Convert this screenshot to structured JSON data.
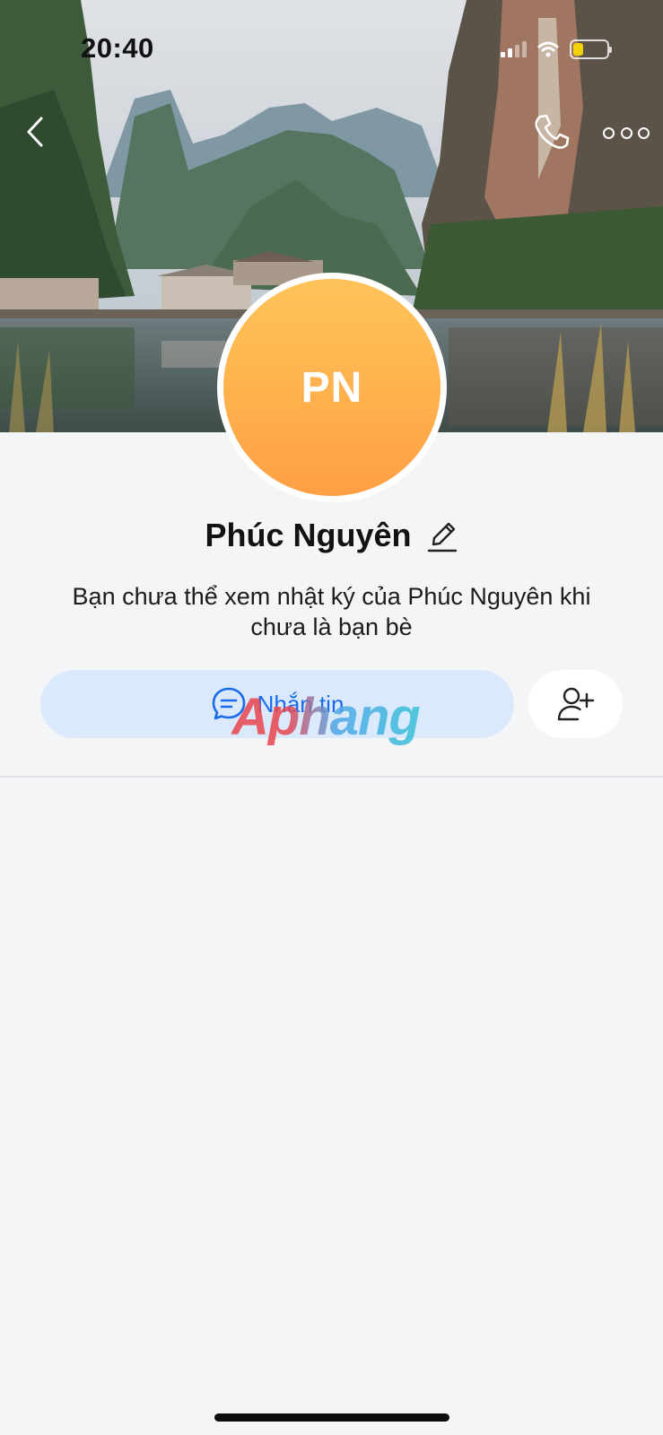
{
  "status_bar": {
    "time": "20:40",
    "battery_level": 0.3,
    "battery_color": "#f4d20a"
  },
  "top_bar": {
    "back_icon": "chevron-left-icon",
    "call_icon": "phone-icon",
    "more_icon": "more-dots-icon"
  },
  "profile": {
    "initials": "PN",
    "avatar_gradient": [
      "#ffc35a",
      "#ff9f45"
    ],
    "name": "Phúc Nguyên",
    "notice": "Bạn chưa thể xem nhật ký của Phúc Nguyên khi chưa là bạn bè"
  },
  "actions": {
    "message_label": "Nhắn tin",
    "message_icon": "chat-bubble-icon",
    "add_friend_icon": "add-user-icon"
  },
  "watermark": {
    "text": "Aphang"
  },
  "colors": {
    "accent": "#1a6bea",
    "message_button_bg": "#dbe9fd",
    "page_bg": "#f4f5f7"
  }
}
